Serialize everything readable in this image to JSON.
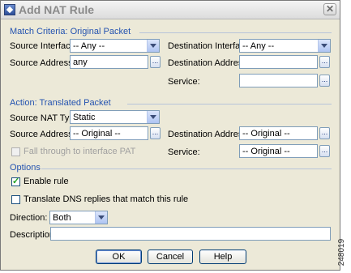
{
  "window": {
    "title": "Add NAT Rule",
    "close_glyph": "✕"
  },
  "match": {
    "section": "Match Criteria: Original Packet",
    "source_interface_label": "Source Interface:",
    "source_interface_value": "-- Any --",
    "destination_interface_label": "Destination Interface:",
    "destination_interface_value": "-- Any --",
    "source_address_label": "Source Address:",
    "source_address_value": "any",
    "destination_address_label": "Destination Address:",
    "destination_address_value": "",
    "service_label": "Service:",
    "service_value": ""
  },
  "action": {
    "section": "Action: Translated Packet",
    "source_nat_type_label": "Source NAT Type:",
    "source_nat_type_value": "Static",
    "source_address_label": "Source Address:",
    "source_address_value": "-- Original --",
    "destination_address_label": "Destination Address:",
    "destination_address_value": "-- Original --",
    "fall_through_label": "Fall through to interface PAT",
    "service_label": "Service:",
    "service_value": "-- Original --"
  },
  "options": {
    "section": "Options",
    "enable_rule_label": "Enable rule",
    "enable_rule_checked": true,
    "translate_dns_label": "Translate DNS replies that match this rule",
    "translate_dns_checked": false,
    "direction_label": "Direction:",
    "direction_value": "Both",
    "description_label": "Description:",
    "description_value": ""
  },
  "buttons": {
    "ok": "OK",
    "cancel": "Cancel",
    "help": "Help"
  },
  "icons": {
    "app": "nat-app-icon",
    "browse": "browse-ellipsis-icon",
    "dropdown": "chevron-down-icon",
    "check": "checkmark-icon"
  },
  "browse_glyph": "...",
  "figure_code": "248019"
}
